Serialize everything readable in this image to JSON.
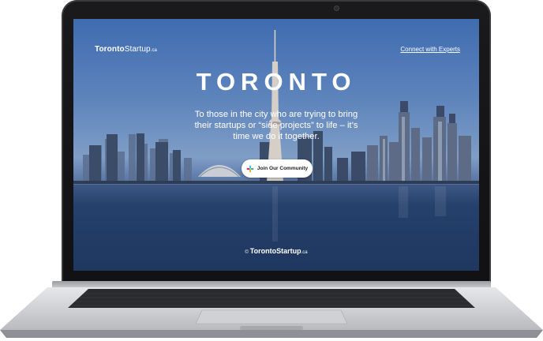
{
  "brand": {
    "name_bold": "Toronto",
    "name_regular": "Startup",
    "tld": ".ca"
  },
  "nav": {
    "connect_link": "Connect with Experts"
  },
  "hero": {
    "title": "TORONTO",
    "tagline": "To those in the city who are trying to bring their startups or “side projects” to life – it’s time we do it together."
  },
  "cta": {
    "label": "Join Our Community",
    "icon": "slack-icon"
  },
  "footer": {
    "copyright_symbol": "©",
    "name_bold": "TorontoStartup",
    "tld": ".ca"
  },
  "colors": {
    "sky_top": "#3f6cb0",
    "water": "#233e6d",
    "bezel": "#111113"
  }
}
